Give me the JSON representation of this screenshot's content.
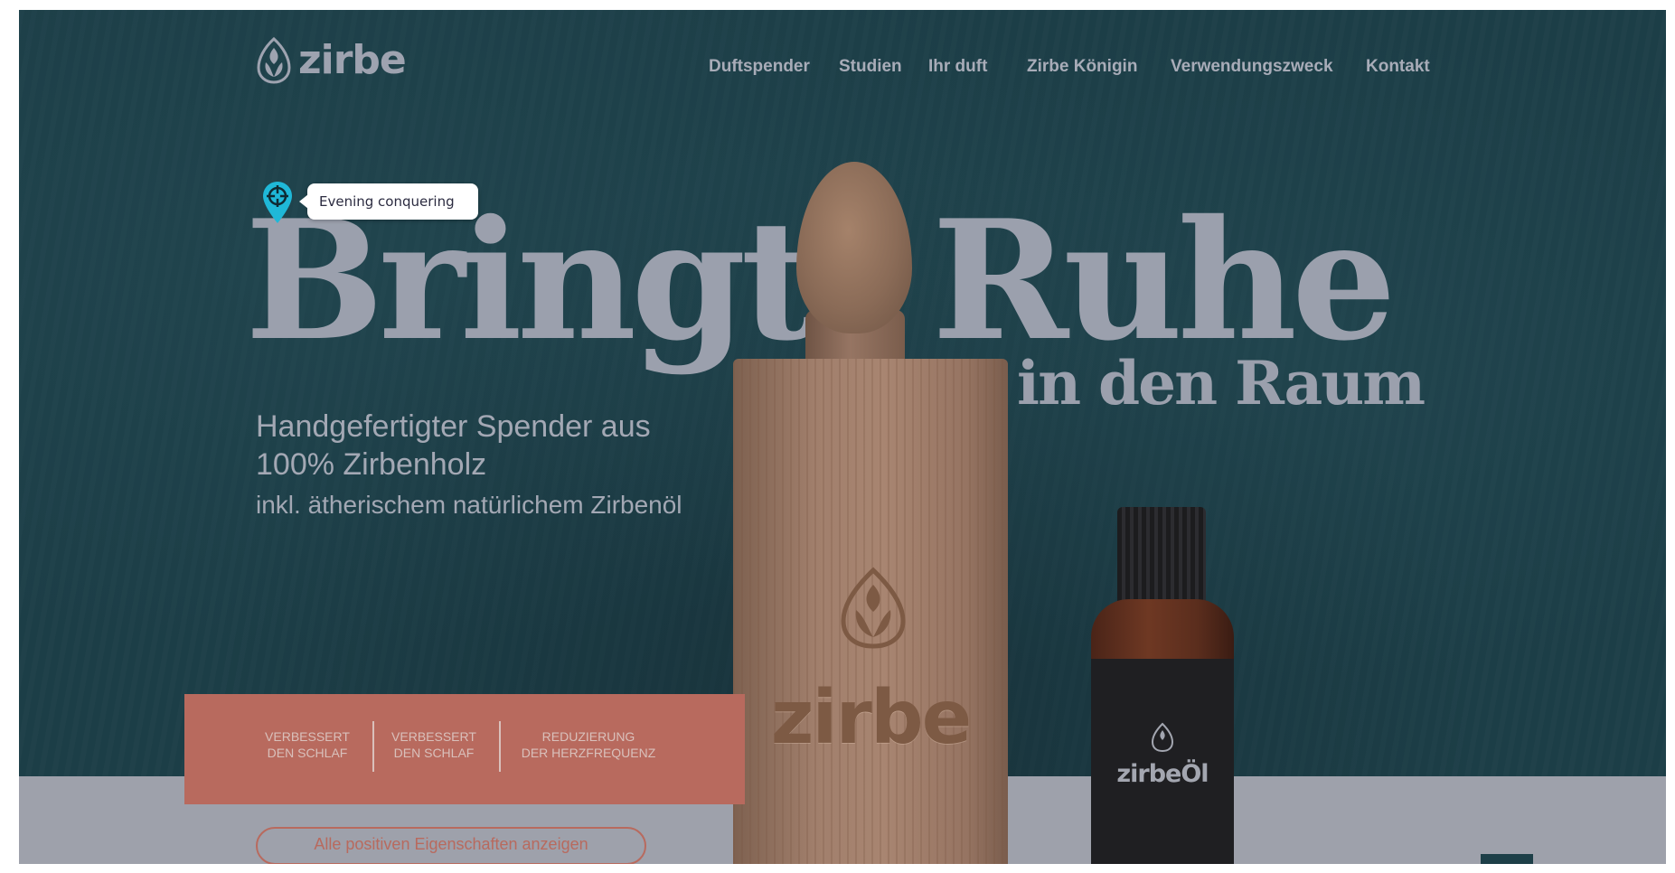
{
  "header": {
    "logo_text": "zirbe",
    "nav": [
      {
        "label": "Duftspender"
      },
      {
        "label": "Studien"
      },
      {
        "label": "Ihr duft"
      },
      {
        "label": "Zirbe Königin"
      },
      {
        "label": "Verwendungszweck"
      },
      {
        "label": "Kontakt"
      }
    ]
  },
  "tooltip": {
    "icon": "target-pin-icon",
    "text": "Evening conquering"
  },
  "hero": {
    "headline_word_1": "Bringt",
    "headline_word_2": "Ruhe",
    "headline_sub": "in den Raum",
    "description_main": "Handgefertigter Spender aus 100% Zirbenholz",
    "description_small": "inkl. ätherischem natürlichem Zirbenöl"
  },
  "benefits": [
    {
      "line1": "VERBESSERT",
      "line2": "DEN SCHLAF"
    },
    {
      "line1": "VERBESSERT",
      "line2": "DEN SCHLAF"
    },
    {
      "line1": "REDUZIERUNG",
      "line2": "DER HERZFREQUENZ"
    }
  ],
  "cta": {
    "label": "Alle positiven Eigenschaften anzeigen"
  },
  "products": {
    "dispenser_brand": "zirbe",
    "oil_brand": "zirbeÖl"
  },
  "colors": {
    "background": "#1d3f48",
    "headline": "#9ba0ad",
    "accent": "#b86a5e",
    "tooltip_pin": "#1fb8d8"
  }
}
